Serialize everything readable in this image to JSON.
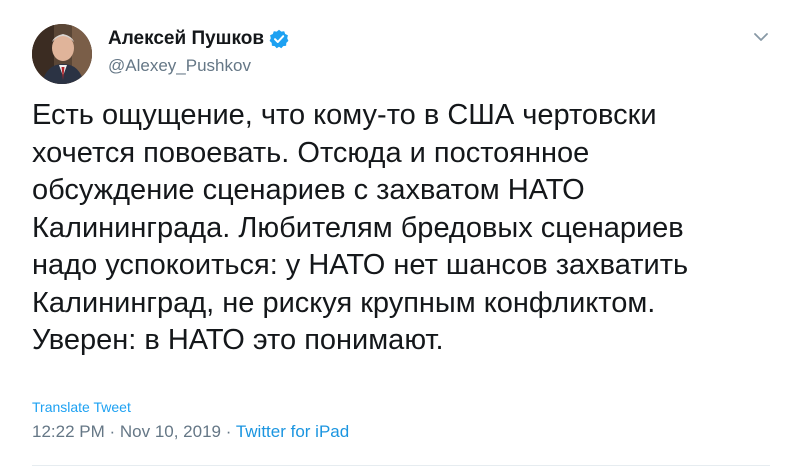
{
  "author": {
    "name": "Алексей Пушков",
    "handle": "@Alexey_Pushkov"
  },
  "tweet_lines": [
    "Есть ощущение, что кому-то в США чертовски",
    "хочется повоевать. Отсюда и постоянное",
    "обсуждение сценариев с захватом НАТО",
    "Калининграда. Любителям бредовых сценариев",
    "надо успокоиться: у НАТО нет шансов захватить",
    "Калининград, не рискуя крупным конфликтом.",
    "Уверен: в НАТО это понимают."
  ],
  "translate_label": "Translate Tweet",
  "meta": {
    "time": "12:22 PM",
    "separator": " · ",
    "date": "Nov 10, 2019",
    "source": "Twitter for iPad"
  },
  "icons": {
    "verified": "verified-badge-icon",
    "caret": "chevron-down-icon"
  },
  "colors": {
    "link": "#1da1f2",
    "muted": "#657786",
    "text": "#14171a",
    "verified": "#1da1f2"
  }
}
